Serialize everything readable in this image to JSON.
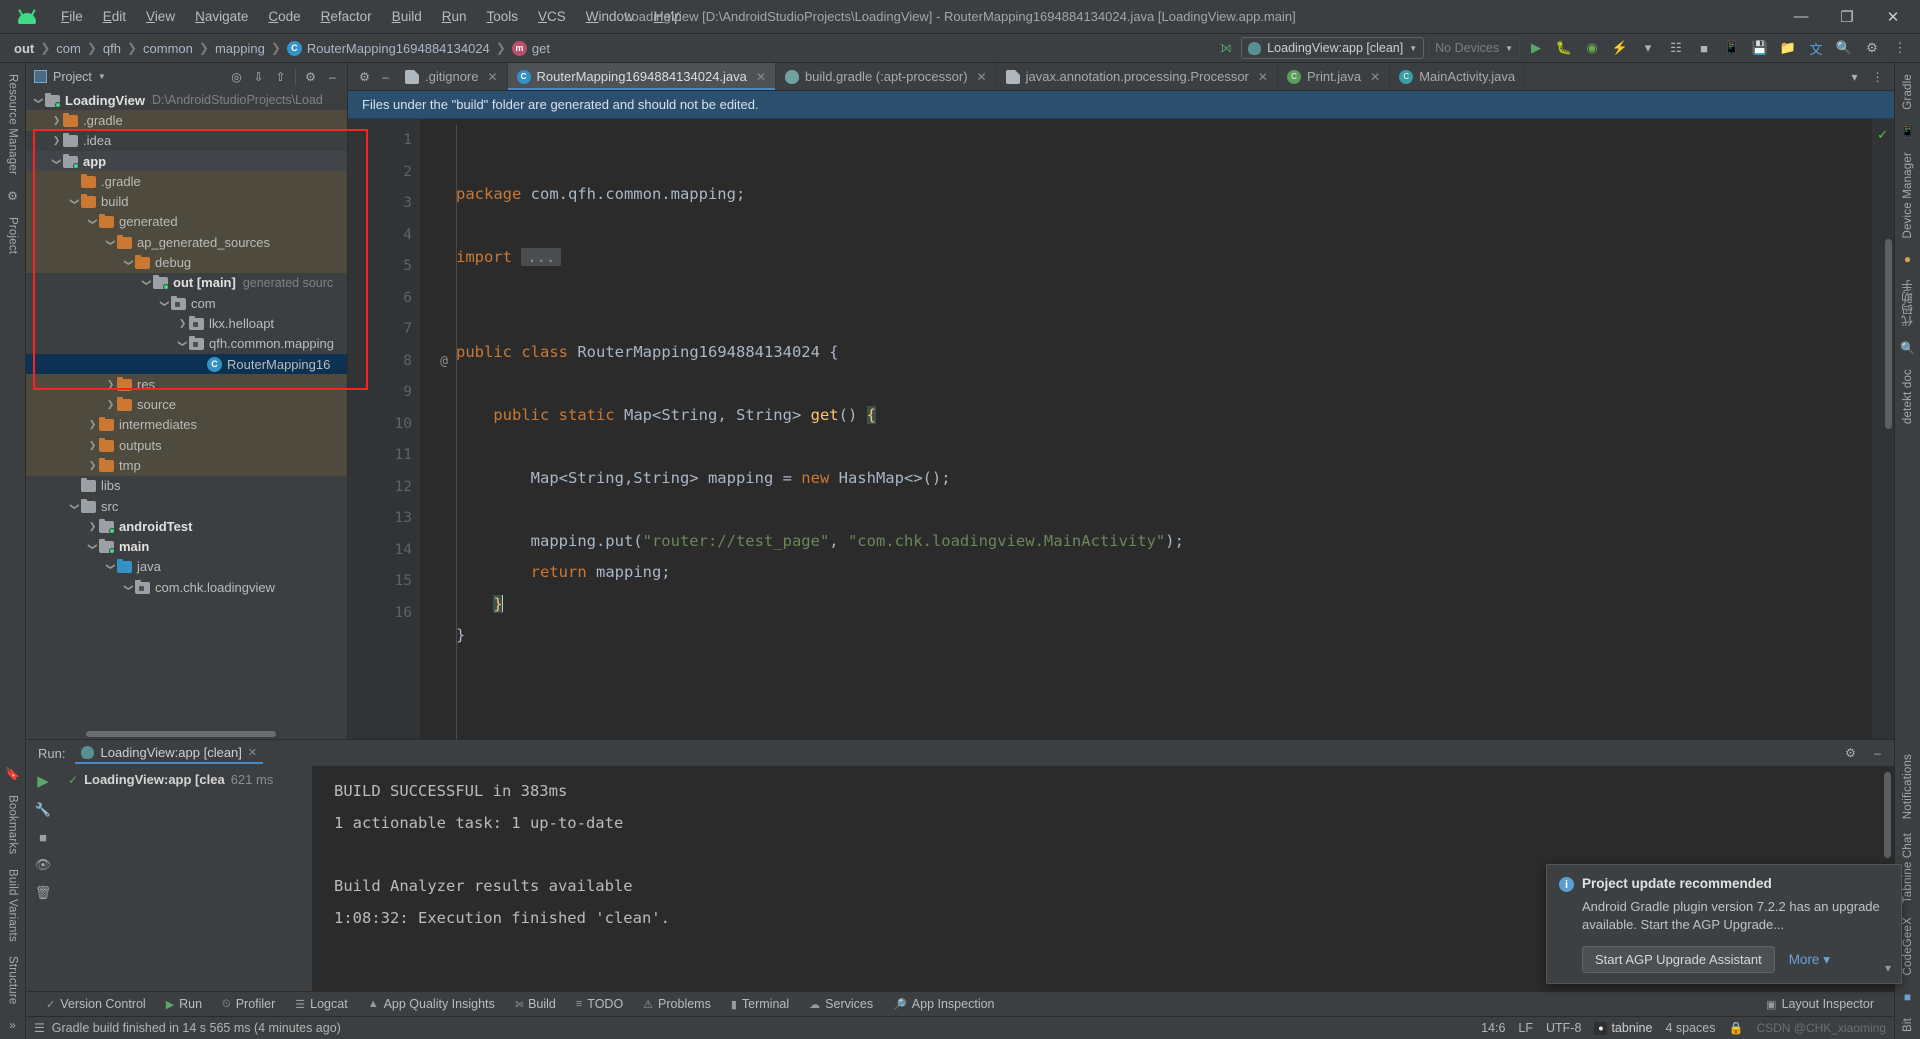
{
  "window": {
    "title": "LoadingView [D:\\AndroidStudioProjects\\LoadingView] - RouterMapping1694884134024.java [LoadingView.app.main]",
    "minimize": "—",
    "maximize": "❐",
    "close": "✕"
  },
  "menu": {
    "items": [
      "File",
      "Edit",
      "View",
      "Navigate",
      "Code",
      "Refactor",
      "Build",
      "Run",
      "Tools",
      "VCS",
      "Window",
      "Help"
    ]
  },
  "breadcrumbs": [
    {
      "label": "out",
      "bold": true,
      "icon": ""
    },
    {
      "label": "com",
      "bold": false,
      "icon": ""
    },
    {
      "label": "qfh",
      "bold": false,
      "icon": ""
    },
    {
      "label": "common",
      "bold": false,
      "icon": ""
    },
    {
      "label": "mapping",
      "bold": false,
      "icon": ""
    },
    {
      "label": "RouterMapping1694884134024",
      "bold": false,
      "icon": "class-icon",
      "glyph": "C"
    },
    {
      "label": "get",
      "bold": false,
      "icon": "method-icon",
      "glyph": "m"
    }
  ],
  "toolbar": {
    "run_config": "LoadingView:app [clean]",
    "devices": "No Devices",
    "icons": [
      "build-hammer-icon",
      "run-icon",
      "debug-icon",
      "run-coverage-icon",
      "profiler-icon",
      "attach-debugger-icon",
      "stop-icon",
      "avd-manager-icon",
      "sdk-manager-icon",
      "device-file-explorer-icon",
      "translate-icon",
      "search-icon",
      "settings-icon",
      "menu-overflow-icon"
    ]
  },
  "project_panel": {
    "title": "Project",
    "tools": [
      "locate-icon",
      "expand-all-icon",
      "collapse-all-icon",
      "settings-icon",
      "hide-icon"
    ],
    "tree": [
      {
        "depth": 0,
        "arrow": "down",
        "icon": "module-folder",
        "label": "LoadingView",
        "bold": true,
        "sub": "D:\\AndroidStudioProjects\\Load",
        "hl": "none"
      },
      {
        "depth": 1,
        "arrow": "right",
        "icon": "folder",
        "label": ".gradle",
        "bold": false,
        "sub": "",
        "hl": "tan"
      },
      {
        "depth": 1,
        "arrow": "right",
        "icon": "folder-grey",
        "label": ".idea",
        "bold": false,
        "sub": "",
        "hl": "none"
      },
      {
        "depth": 1,
        "arrow": "down",
        "icon": "module-folder",
        "label": "app",
        "bold": true,
        "sub": "",
        "hl": "grey"
      },
      {
        "depth": 2,
        "arrow": "none",
        "icon": "folder",
        "label": ".gradle",
        "bold": false,
        "sub": "",
        "hl": "tan"
      },
      {
        "depth": 2,
        "arrow": "down",
        "icon": "folder",
        "label": "build",
        "bold": false,
        "sub": "",
        "hl": "tan"
      },
      {
        "depth": 3,
        "arrow": "down",
        "icon": "folder",
        "label": "generated",
        "bold": false,
        "sub": "",
        "hl": "tan"
      },
      {
        "depth": 4,
        "arrow": "down",
        "icon": "folder",
        "label": "ap_generated_sources",
        "bold": false,
        "sub": "",
        "hl": "tan"
      },
      {
        "depth": 5,
        "arrow": "down",
        "icon": "folder",
        "label": "debug",
        "bold": false,
        "sub": "",
        "hl": "tan"
      },
      {
        "depth": 6,
        "arrow": "down",
        "icon": "module-folder",
        "label": "out [main]",
        "bold": true,
        "sub": "generated sourc",
        "hl": "none"
      },
      {
        "depth": 7,
        "arrow": "down",
        "icon": "package",
        "label": "com",
        "bold": false,
        "sub": "",
        "hl": "none"
      },
      {
        "depth": 8,
        "arrow": "right",
        "icon": "package",
        "label": "lkx.helloapt",
        "bold": false,
        "sub": "",
        "hl": "none"
      },
      {
        "depth": 8,
        "arrow": "down",
        "icon": "package",
        "label": "qfh.common.mapping",
        "bold": false,
        "sub": "",
        "hl": "none"
      },
      {
        "depth": 9,
        "arrow": "none",
        "icon": "class",
        "label": "RouterMapping16",
        "bold": false,
        "sub": "",
        "hl": "selected"
      },
      {
        "depth": 4,
        "arrow": "right",
        "icon": "folder",
        "label": "res",
        "bold": false,
        "sub": "",
        "hl": "tan"
      },
      {
        "depth": 4,
        "arrow": "right",
        "icon": "folder",
        "label": "source",
        "bold": false,
        "sub": "",
        "hl": "tan"
      },
      {
        "depth": 3,
        "arrow": "right",
        "icon": "folder",
        "label": "intermediates",
        "bold": false,
        "sub": "",
        "hl": "tan"
      },
      {
        "depth": 3,
        "arrow": "right",
        "icon": "folder",
        "label": "outputs",
        "bold": false,
        "sub": "",
        "hl": "tan"
      },
      {
        "depth": 3,
        "arrow": "right",
        "icon": "folder",
        "label": "tmp",
        "bold": false,
        "sub": "",
        "hl": "tan"
      },
      {
        "depth": 2,
        "arrow": "none",
        "icon": "folder-grey",
        "label": "libs",
        "bold": false,
        "sub": "",
        "hl": "none"
      },
      {
        "depth": 2,
        "arrow": "down",
        "icon": "folder-grey",
        "label": "src",
        "bold": false,
        "sub": "",
        "hl": "none"
      },
      {
        "depth": 3,
        "arrow": "right",
        "icon": "module-folder",
        "label": "androidTest",
        "bold": true,
        "sub": "",
        "hl": "none"
      },
      {
        "depth": 3,
        "arrow": "down",
        "icon": "module-folder",
        "label": "main",
        "bold": true,
        "sub": "",
        "hl": "none"
      },
      {
        "depth": 4,
        "arrow": "down",
        "icon": "folder-blue",
        "label": "java",
        "bold": false,
        "sub": "",
        "hl": "none"
      },
      {
        "depth": 5,
        "arrow": "down",
        "icon": "package",
        "label": "com.chk.loadingview",
        "bold": false,
        "sub": "",
        "hl": "none"
      }
    ]
  },
  "editor": {
    "tabs": [
      {
        "label": ".gitignore",
        "icon": "file-icon",
        "active": false,
        "closable": true
      },
      {
        "label": "RouterMapping1694884134024.java",
        "icon": "java-class-icon",
        "active": true,
        "closable": true
      },
      {
        "label": "build.gradle (:apt-processor)",
        "icon": "gradle-icon",
        "active": false,
        "closable": true
      },
      {
        "label": "javax.annotation.processing.Processor",
        "icon": "file-icon",
        "active": false,
        "closable": true
      },
      {
        "label": "Print.java",
        "icon": "java-class-icon",
        "active": false,
        "closable": true
      },
      {
        "label": "MainActivity.java",
        "icon": "java-class-icon",
        "active": false,
        "closable": true
      }
    ],
    "notice": "Files under the \"build\" folder are generated and should not be edited.",
    "line_numbers": [
      "1",
      "2",
      "3",
      "4",
      "5",
      "6",
      "7",
      "8",
      "9",
      "10",
      "11",
      "12",
      "13",
      "14",
      "15",
      "16"
    ],
    "code_lines": [
      {
        "n": 1,
        "text": "package com.qfh.common.mapping;"
      },
      {
        "n": 2,
        "text": ""
      },
      {
        "n": 3,
        "text": "import ..."
      },
      {
        "n": 4,
        "text": ""
      },
      {
        "n": 5,
        "text": ""
      },
      {
        "n": 6,
        "text": "public class RouterMapping1694884134024 {"
      },
      {
        "n": 7,
        "text": ""
      },
      {
        "n": 8,
        "text": "    public static Map<String, String> get() {"
      },
      {
        "n": 9,
        "text": ""
      },
      {
        "n": 10,
        "text": "        Map<String,String> mapping = new HashMap<>();"
      },
      {
        "n": 11,
        "text": ""
      },
      {
        "n": 12,
        "text": "        mapping.put(\"router://test_page\", \"com.chk.loadingview.MainActivity\");"
      },
      {
        "n": 13,
        "text": "        return mapping;"
      },
      {
        "n": 14,
        "text": "    }"
      },
      {
        "n": 15,
        "text": "}"
      },
      {
        "n": 16,
        "text": ""
      }
    ],
    "annotation_marker": "@"
  },
  "run_panel": {
    "label": "Run:",
    "tab": "LoadingView:app [clean]",
    "tree_item": "LoadingView:app [clea",
    "tree_time": "621 ms",
    "console": [
      "BUILD SUCCESSFUL in 383ms",
      "1 actionable task: 1 up-to-date",
      "",
      "Build Analyzer results available",
      "1:08:32: Execution finished 'clean'."
    ]
  },
  "notification": {
    "title": "Project update recommended",
    "body": "Android Gradle plugin version 7.2.2 has an upgrade available. Start the AGP Upgrade...",
    "primary_button": "Start AGP Upgrade Assistant",
    "link": "More"
  },
  "bottom_toolbar": {
    "items": [
      {
        "label": "Version Control",
        "icon": "vcs-icon"
      },
      {
        "label": "Run",
        "icon": "run-icon"
      },
      {
        "label": "Profiler",
        "icon": "profiler-icon"
      },
      {
        "label": "Logcat",
        "icon": "logcat-icon"
      },
      {
        "label": "App Quality Insights",
        "icon": "insights-icon"
      },
      {
        "label": "Build",
        "icon": "build-icon"
      },
      {
        "label": "TODO",
        "icon": "todo-icon"
      },
      {
        "label": "Problems",
        "icon": "problems-icon"
      },
      {
        "label": "Terminal",
        "icon": "terminal-icon"
      },
      {
        "label": "Services",
        "icon": "services-icon"
      },
      {
        "label": "App Inspection",
        "icon": "inspection-icon"
      }
    ],
    "right": "Layout Inspector"
  },
  "status_bar": {
    "message": "Gradle build finished in 14 s 565 ms (4 minutes ago)",
    "caret_position": "14:6",
    "line_separator": "LF",
    "encoding": "UTF-8",
    "plugin": "tabnine",
    "indent": "4 spaces",
    "lock_icon": "lock-icon",
    "watermark": "CSDN @CHK_xiaoming"
  },
  "left_strip": {
    "top_labels": [
      "Resource Manager",
      "Project"
    ],
    "bottom_labels": [
      "Bookmarks",
      "Build Variants",
      "Structure"
    ]
  },
  "right_strip": {
    "labels": [
      "Gradle",
      "Device Manager",
      "Notifications",
      "Tabnine Chat",
      "CodeGeeX",
      "Bit"
    ]
  },
  "colors": {
    "accent_blue": "#4a88c7",
    "selection": "#0d3152",
    "folder_orange": "#cb7832",
    "green": "#59a869",
    "annotation_red": "#ff2020"
  }
}
